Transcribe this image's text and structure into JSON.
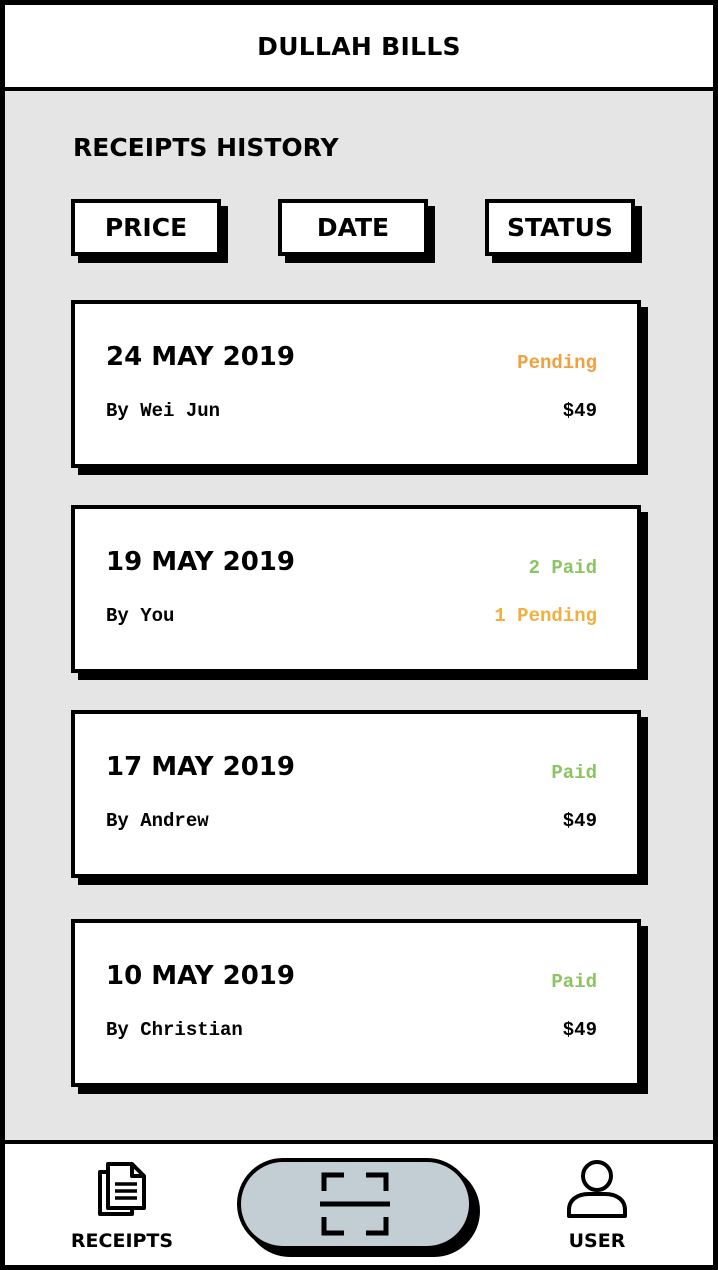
{
  "app": {
    "title": "DULLAH BILLS"
  },
  "receipts": {
    "title": "RECEIPTS HISTORY",
    "sort_buttons": [
      {
        "label": "PRICE"
      },
      {
        "label": "DATE"
      },
      {
        "label": "STATUS"
      }
    ],
    "items": [
      {
        "date": "24 MAY 2019",
        "by": "By Wei Jun",
        "status": "Pending",
        "status_color": "#f0a040",
        "amount": "$49",
        "amount_color": "#000000"
      },
      {
        "date": "19 MAY 2019",
        "by": "By You",
        "status": "2 Paid",
        "status_color": "#8cc464",
        "amount": "1 Pending",
        "amount_color": "#f0b040"
      },
      {
        "date": "17 MAY 2019",
        "by": "By Andrew",
        "status": "Paid",
        "status_color": "#8cc464",
        "amount": "$49",
        "amount_color": "#000000"
      },
      {
        "date": "10 MAY 2019",
        "by": "By Christian",
        "status": "Paid",
        "status_color": "#8cc464",
        "amount": "$49",
        "amount_color": "#000000"
      }
    ]
  },
  "nav": {
    "receipts_label": "RECEIPTS",
    "receipts_icon": "documents-icon",
    "scan_icon": "scan-icon",
    "user_label": "USER",
    "user_icon": "user-icon",
    "scan_button_color": "#c2cdd4"
  }
}
